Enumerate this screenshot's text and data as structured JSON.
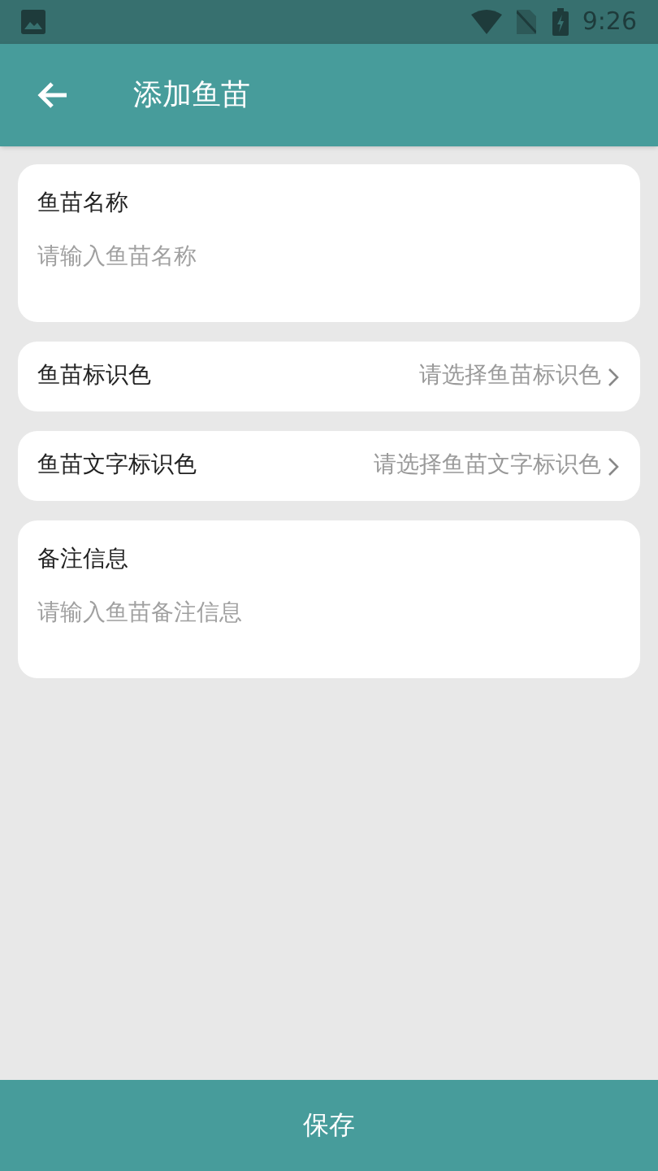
{
  "status_bar": {
    "time": "9:26"
  },
  "app_bar": {
    "title": "添加鱼苗"
  },
  "fields": [
    {
      "kind": "input",
      "label": "鱼苗名称",
      "placeholder": "请输入鱼苗名称"
    },
    {
      "kind": "select",
      "label": "鱼苗标识色",
      "placeholder": "请选择鱼苗标识色"
    },
    {
      "kind": "select",
      "label": "鱼苗文字标识色",
      "placeholder": "请选择鱼苗文字标识色"
    },
    {
      "kind": "input",
      "label": "备注信息",
      "placeholder": "请输入鱼苗备注信息"
    }
  ],
  "save_button": {
    "label": "保存"
  }
}
